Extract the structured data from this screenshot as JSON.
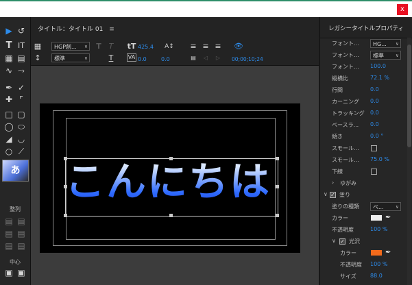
{
  "window": {
    "close_label": "x"
  },
  "tools": {
    "section_align": "整列",
    "section_center": "中心"
  },
  "header": {
    "tab_title": "タイトル：タイトル 01",
    "menu_icon": "hamburger-icon"
  },
  "toolbar": {
    "font_family": "HGP創...",
    "font_style": "標準",
    "font_size": "425.4",
    "kerning": "0.0",
    "leading": "0.0",
    "timecode": "00;00;10;24"
  },
  "canvas": {
    "text": "こんにちは"
  },
  "properties": {
    "title": "レガシータイトルプロパティ",
    "rows": {
      "font_family": {
        "label": "フォント...",
        "value": "HG..."
      },
      "font_style": {
        "label": "フォント...",
        "value": "標準"
      },
      "font_size": {
        "label": "フォント...",
        "value": "100.0"
      },
      "aspect": {
        "label": "縦横比",
        "value": "72.1 %"
      },
      "leading": {
        "label": "行間",
        "value": "0.0"
      },
      "kerning": {
        "label": "カーニング",
        "value": "0.0"
      },
      "tracking": {
        "label": "トラッキング",
        "value": "0.0"
      },
      "baseline": {
        "label": "ベースラ...",
        "value": "0.0"
      },
      "slant": {
        "label": "傾き",
        "value": "0.0 °"
      },
      "smallcaps": {
        "label": "スモール..."
      },
      "smallcaps_size": {
        "label": "スモール...",
        "value": "75.0 %"
      },
      "underline": {
        "label": "下線"
      },
      "distort": {
        "label": "ゆがみ"
      },
      "fill": {
        "label": "塗り"
      },
      "fill_type": {
        "label": "塗りの種類",
        "value": "ベ..."
      },
      "color": {
        "label": "カラー"
      },
      "opacity": {
        "label": "不透明度",
        "value": "100 %"
      },
      "sheen": {
        "label": "光沢"
      },
      "sheen_color": {
        "label": "カラー"
      },
      "sheen_opacity": {
        "label": "不透明度",
        "value": "100 %"
      },
      "sheen_size": {
        "label": "サイズ",
        "value": "88.0"
      }
    },
    "colors": {
      "fill_color": "#f0f0f0",
      "sheen_color": "#f26a1b"
    }
  }
}
